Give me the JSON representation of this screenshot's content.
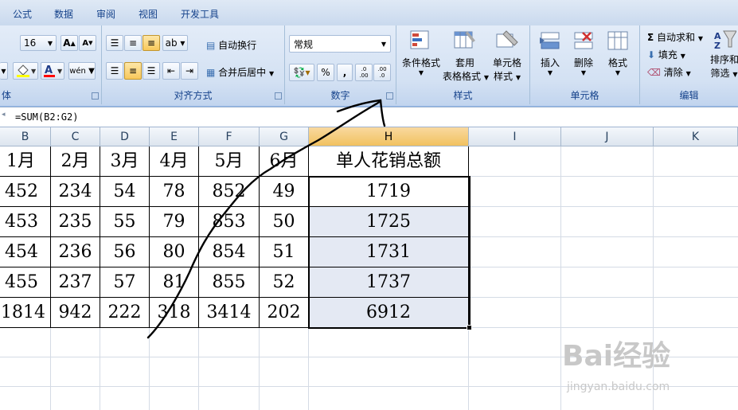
{
  "menu": [
    "公式",
    "数据",
    "审阅",
    "视图",
    "开发工具"
  ],
  "font": {
    "size": "16",
    "grow": "A",
    "shrink": "A",
    "group_label": "体"
  },
  "alignment": {
    "wrap_label": "自动换行",
    "merge_label": "合并后居中",
    "group_label": "对齐方式"
  },
  "number": {
    "format": "常规",
    "percent": "%",
    "comma": ",",
    "inc_decimal": ".0 .00",
    "dec_decimal": ".00 .0",
    "group_label": "数字"
  },
  "styles": {
    "conditional": "条件格式",
    "table_line1": "套用",
    "table_line2": "表格格式",
    "cell_line1": "单元格",
    "cell_line2": "样式",
    "group_label": "样式"
  },
  "cells": {
    "insert": "插入",
    "delete": "删除",
    "format": "格式",
    "group_label": "单元格"
  },
  "editing": {
    "autosum": "自动求和",
    "fill": "填充",
    "clear": "清除",
    "sort_line1": "排序和",
    "sort_line2": "筛选",
    "group_label": "编辑"
  },
  "formula": "=SUM(B2:G2)",
  "columns": [
    "B",
    "C",
    "D",
    "E",
    "F",
    "G",
    "H",
    "I",
    "J",
    "K"
  ],
  "header_row": [
    "1月",
    "2月",
    "3月",
    "4月",
    "5月",
    "6月",
    "单人花销总额"
  ],
  "rows": [
    [
      "452",
      "234",
      "54",
      "78",
      "852",
      "49",
      "1719"
    ],
    [
      "453",
      "235",
      "55",
      "79",
      "853",
      "50",
      "1725"
    ],
    [
      "454",
      "236",
      "56",
      "80",
      "854",
      "51",
      "1731"
    ],
    [
      "455",
      "237",
      "57",
      "81",
      "855",
      "52",
      "1737"
    ],
    [
      "1814",
      "942",
      "222",
      "318",
      "3414",
      "202",
      "6912"
    ]
  ],
  "watermark": {
    "brand": "Bai经验",
    "url": "jingyan.baidu.com"
  },
  "colors": {
    "selected_header": "#f1c15f",
    "selection_fill": "#e4e9f3",
    "ribbon": "#d3e1f3"
  }
}
